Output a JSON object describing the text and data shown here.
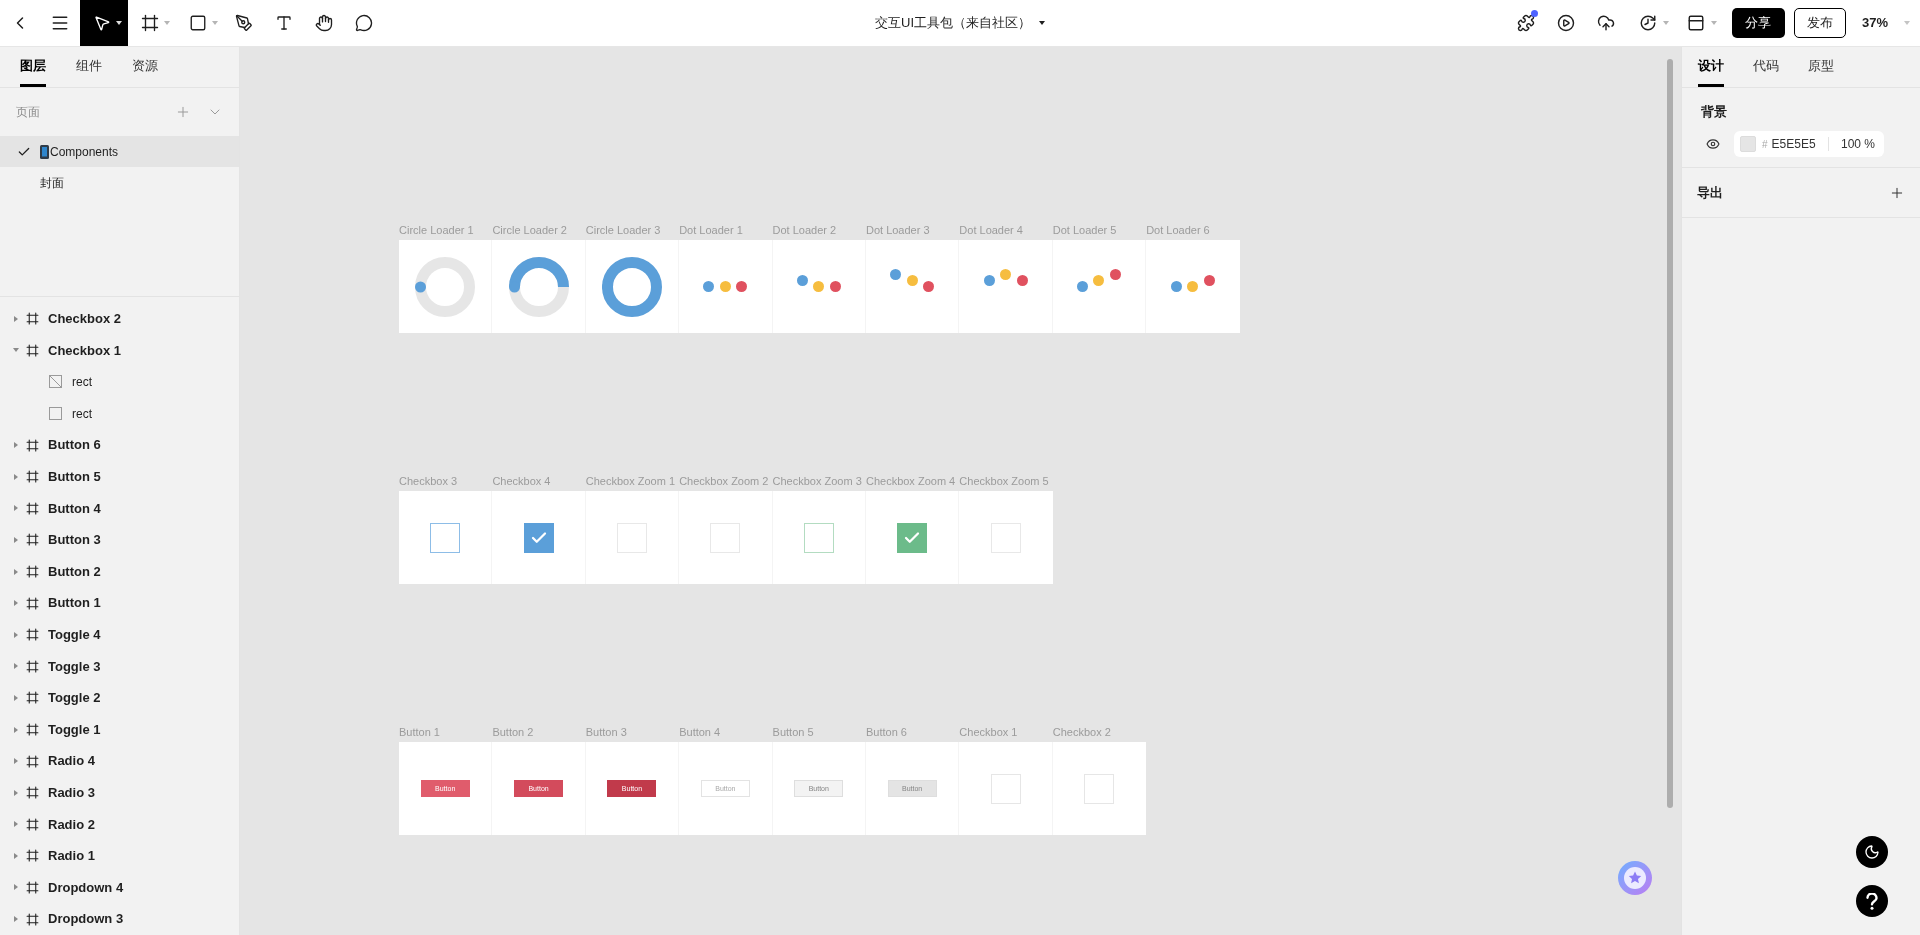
{
  "toolbar": {
    "nav": [
      {
        "kind": "back"
      },
      {
        "kind": "menu"
      }
    ],
    "tools": [
      {
        "kind": "select",
        "selected": true,
        "has_menu": true
      },
      {
        "kind": "frame",
        "selected": false,
        "has_menu": true
      },
      {
        "kind": "rectangle",
        "selected": false,
        "has_menu": true
      },
      {
        "kind": "pen",
        "selected": false,
        "has_menu": false
      },
      {
        "kind": "text",
        "selected": false,
        "has_menu": false
      },
      {
        "kind": "hand",
        "selected": false,
        "has_menu": false
      },
      {
        "kind": "comment",
        "selected": false,
        "has_menu": false
      }
    ],
    "title": "交互UI工具包（来自社区）",
    "actions": [
      {
        "kind": "plugins",
        "badge": true,
        "has_menu": false
      },
      {
        "kind": "present",
        "badge": false,
        "has_menu": false
      },
      {
        "kind": "upload",
        "badge": false,
        "has_menu": false
      },
      {
        "kind": "history",
        "badge": false,
        "has_menu": true
      },
      {
        "kind": "layout",
        "badge": false,
        "has_menu": true
      }
    ],
    "share": "分享",
    "publish": "发布",
    "zoom": "37%"
  },
  "left_panel": {
    "tabs": [
      {
        "label": "图层",
        "selected": true
      },
      {
        "label": "组件",
        "selected": false
      },
      {
        "label": "资源",
        "selected": false
      }
    ],
    "pages": {
      "title": "页面",
      "items": [
        {
          "name": "Components",
          "kind": "phone",
          "selected": true
        },
        {
          "name": "封面",
          "kind": "plain",
          "selected": false
        }
      ]
    },
    "layers": [
      {
        "name": "Checkbox 2",
        "kind": "frame",
        "expanded": false
      },
      {
        "name": "Checkbox 1",
        "kind": "frame",
        "expanded": true,
        "children": [
          {
            "name": "rect",
            "kind": "slice"
          },
          {
            "name": "rect",
            "kind": "rectangle"
          }
        ]
      },
      {
        "name": "Button 6",
        "kind": "frame",
        "expanded": false
      },
      {
        "name": "Button 5",
        "kind": "frame",
        "expanded": false
      },
      {
        "name": "Button 4",
        "kind": "frame",
        "expanded": false
      },
      {
        "name": "Button 3",
        "kind": "frame",
        "expanded": false
      },
      {
        "name": "Button 2",
        "kind": "frame",
        "expanded": false
      },
      {
        "name": "Button 1",
        "kind": "frame",
        "expanded": false
      },
      {
        "name": "Toggle 4",
        "kind": "frame",
        "expanded": false
      },
      {
        "name": "Toggle 3",
        "kind": "frame",
        "expanded": false
      },
      {
        "name": "Toggle 2",
        "kind": "frame",
        "expanded": false
      },
      {
        "name": "Toggle 1",
        "kind": "frame",
        "expanded": false
      },
      {
        "name": "Radio 4",
        "kind": "frame",
        "expanded": false
      },
      {
        "name": "Radio 3",
        "kind": "frame",
        "expanded": false
      },
      {
        "name": "Radio 2",
        "kind": "frame",
        "expanded": false
      },
      {
        "name": "Radio 1",
        "kind": "frame",
        "expanded": false
      },
      {
        "name": "Dropdown 4",
        "kind": "frame",
        "expanded": false
      },
      {
        "name": "Dropdown 3",
        "kind": "frame",
        "expanded": false
      }
    ]
  },
  "canvas": {
    "frames": [
      {
        "cells": [
          {
            "label": "Circle Loader 1",
            "kind": "ring-dot"
          },
          {
            "label": "Circle Loader 2",
            "kind": "ring-half"
          },
          {
            "label": "Circle Loader 3",
            "kind": "ring-full"
          },
          {
            "label": "Dot Loader 1",
            "kind": "dots",
            "dots": [
              {
                "color": "#5b9fd9",
                "kind": "low"
              },
              {
                "color": "#f6bd3f",
                "kind": "low"
              },
              {
                "color": "#e0515f",
                "kind": "low"
              }
            ]
          },
          {
            "label": "Dot Loader 2",
            "kind": "dots",
            "dots": [
              {
                "color": "#5b9fd9",
                "kind": "mid"
              },
              {
                "color": "#f6bd3f",
                "kind": "low"
              },
              {
                "color": "#e0515f",
                "kind": "low"
              }
            ]
          },
          {
            "label": "Dot Loader 3",
            "kind": "dots",
            "dots": [
              {
                "color": "#5b9fd9",
                "kind": "high"
              },
              {
                "color": "#f6bd3f",
                "kind": "mid"
              },
              {
                "color": "#e0515f",
                "kind": "low"
              }
            ]
          },
          {
            "label": "Dot Loader 4",
            "kind": "dots",
            "dots": [
              {
                "color": "#5b9fd9",
                "kind": "mid"
              },
              {
                "color": "#f6bd3f",
                "kind": "high"
              },
              {
                "color": "#e0515f",
                "kind": "mid"
              }
            ]
          },
          {
            "label": "Dot Loader 5",
            "kind": "dots",
            "dots": [
              {
                "color": "#5b9fd9",
                "kind": "low"
              },
              {
                "color": "#f6bd3f",
                "kind": "mid"
              },
              {
                "color": "#e0515f",
                "kind": "high"
              }
            ]
          },
          {
            "label": "Dot Loader 6",
            "kind": "dots",
            "dots": [
              {
                "color": "#5b9fd9",
                "kind": "low"
              },
              {
                "color": "#f6bd3f",
                "kind": "low"
              },
              {
                "color": "#e0515f",
                "kind": "mid"
              }
            ]
          }
        ]
      },
      {
        "cells": [
          {
            "label": "Checkbox 3",
            "kind": "checkbox",
            "checked": false,
            "color": "#8dbde7"
          },
          {
            "label": "Checkbox 4",
            "kind": "checkbox",
            "checked": true,
            "color": "#5b9fd9"
          },
          {
            "label": "Checkbox Zoom 1",
            "kind": "checkbox",
            "checked": false,
            "color": "#e8e8e8"
          },
          {
            "label": "Checkbox Zoom 2",
            "kind": "checkbox",
            "checked": false,
            "color": "#e8e8e8"
          },
          {
            "label": "Checkbox Zoom 3",
            "kind": "checkbox",
            "checked": false,
            "color": "#b3dcc1"
          },
          {
            "label": "Checkbox Zoom 4",
            "kind": "checkbox",
            "checked": true,
            "color": "#6cbb8a"
          },
          {
            "label": "Checkbox Zoom 5",
            "kind": "checkbox",
            "checked": false,
            "color": "#e8e8e8"
          }
        ]
      },
      {
        "cells": [
          {
            "label": "Button 1",
            "kind": "filled",
            "color": "#e05c6c",
            "text": "Button"
          },
          {
            "label": "Button 2",
            "kind": "filled",
            "color": "#d34b5c",
            "text": "Button"
          },
          {
            "label": "Button 3",
            "kind": "filled",
            "color": "#c13a4b",
            "text": "Button"
          },
          {
            "label": "Button 4",
            "kind": "outline",
            "color": "#ffffff",
            "text": "Button"
          },
          {
            "label": "Button 5",
            "kind": "tinted",
            "color": "#f3f3f3",
            "text": "Button"
          },
          {
            "label": "Button 6",
            "kind": "tinted",
            "color": "#e4e4e4",
            "text": "Button"
          },
          {
            "label": "Checkbox 1",
            "kind": "checkbox",
            "checked": false,
            "color": "#e6e6e6"
          },
          {
            "label": "Checkbox 2",
            "kind": "checkbox",
            "checked": false,
            "color": "#e6e6e6"
          }
        ]
      }
    ]
  },
  "right_panel": {
    "tabs": [
      {
        "label": "设计",
        "selected": true
      },
      {
        "label": "代码",
        "selected": false
      },
      {
        "label": "原型",
        "selected": false
      }
    ],
    "background": {
      "title": "背景",
      "visible": true,
      "color": "#e5e5e5",
      "prefix": "#",
      "hex": "E5E5E5",
      "opacity": "100 %"
    },
    "export": {
      "title": "导出"
    }
  }
}
